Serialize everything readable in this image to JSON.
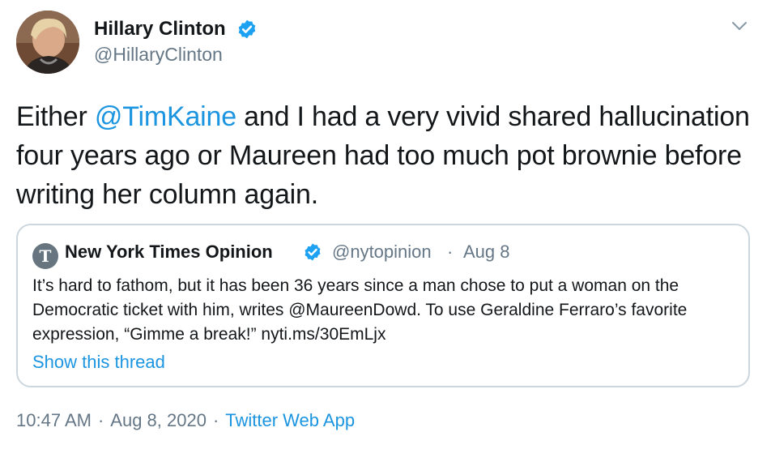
{
  "author": {
    "name": "Hillary Clinton",
    "handle": "@HillaryClinton",
    "verified": true
  },
  "tweet": {
    "text_before": "Either ",
    "mention": "@TimKaine",
    "text_after": " and I had a very vivid shared hallucination four years ago or Maureen had too much pot brownie before writing her column again."
  },
  "quote": {
    "avatar_glyph": "T",
    "name": "New York Times Opinion",
    "handle": "@nytopinion",
    "separator": "·",
    "date": "Aug 8",
    "text": "It’s hard to fathom, but it has been 36 years since a man chose to put a woman on the Democratic ticket with him, writes @MaureenDowd. To use Geraldine Ferraro’s favorite expression, “Gimme a break!” nyti.ms/30EmLjx",
    "show_thread": "Show this thread"
  },
  "meta": {
    "time": "10:47 AM",
    "separator": "·",
    "date": "Aug 8, 2020",
    "source": "Twitter Web App"
  },
  "icons": {
    "verified": "verified-badge-icon",
    "caret": "chevron-down-icon"
  },
  "colors": {
    "link": "#1b95e0",
    "secondary": "#657786",
    "border": "#ccd6dd",
    "verified": "#1da1f2"
  }
}
